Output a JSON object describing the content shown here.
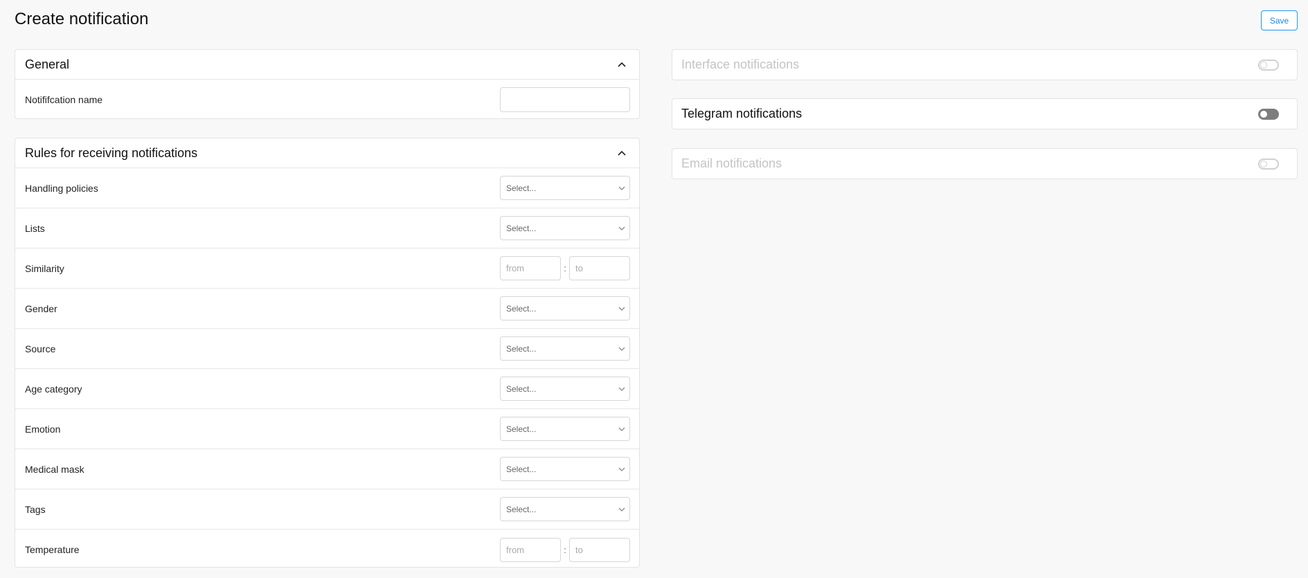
{
  "page": {
    "title": "Create notification",
    "save_label": "Save"
  },
  "general": {
    "title": "General",
    "name_label": "Notififcation name",
    "name_value": ""
  },
  "rules": {
    "title": "Rules for receiving notifications",
    "handling_policies": {
      "label": "Handling policies",
      "placeholder": "Select..."
    },
    "lists": {
      "label": "Lists",
      "placeholder": "Select..."
    },
    "similarity": {
      "label": "Similarity",
      "from": "from",
      "sep": ":",
      "to": "to"
    },
    "gender": {
      "label": "Gender",
      "placeholder": "Select..."
    },
    "source": {
      "label": "Source",
      "placeholder": "Select..."
    },
    "age_category": {
      "label": "Age category",
      "placeholder": "Select..."
    },
    "emotion": {
      "label": "Emotion",
      "placeholder": "Select..."
    },
    "medical_mask": {
      "label": "Medical mask",
      "placeholder": "Select..."
    },
    "tags": {
      "label": "Tags",
      "placeholder": "Select..."
    },
    "temperature": {
      "label": "Temperature",
      "from": "from",
      "sep": ":",
      "to": "to"
    }
  },
  "notifications": {
    "interface": {
      "title": "Interface notifications",
      "enabled": false,
      "disabled_state": true
    },
    "telegram": {
      "title": "Telegram notifications",
      "enabled": false,
      "disabled_state": false
    },
    "email": {
      "title": "Email notifications",
      "enabled": false,
      "disabled_state": true
    }
  },
  "colors": {
    "accent": "#1e88e5",
    "toggle_active": "#7d7d7d",
    "muted_text": "#c4c4c4"
  },
  "icons": {
    "collapse": "chevron-up-icon",
    "dropdown": "chevron-down-icon"
  }
}
